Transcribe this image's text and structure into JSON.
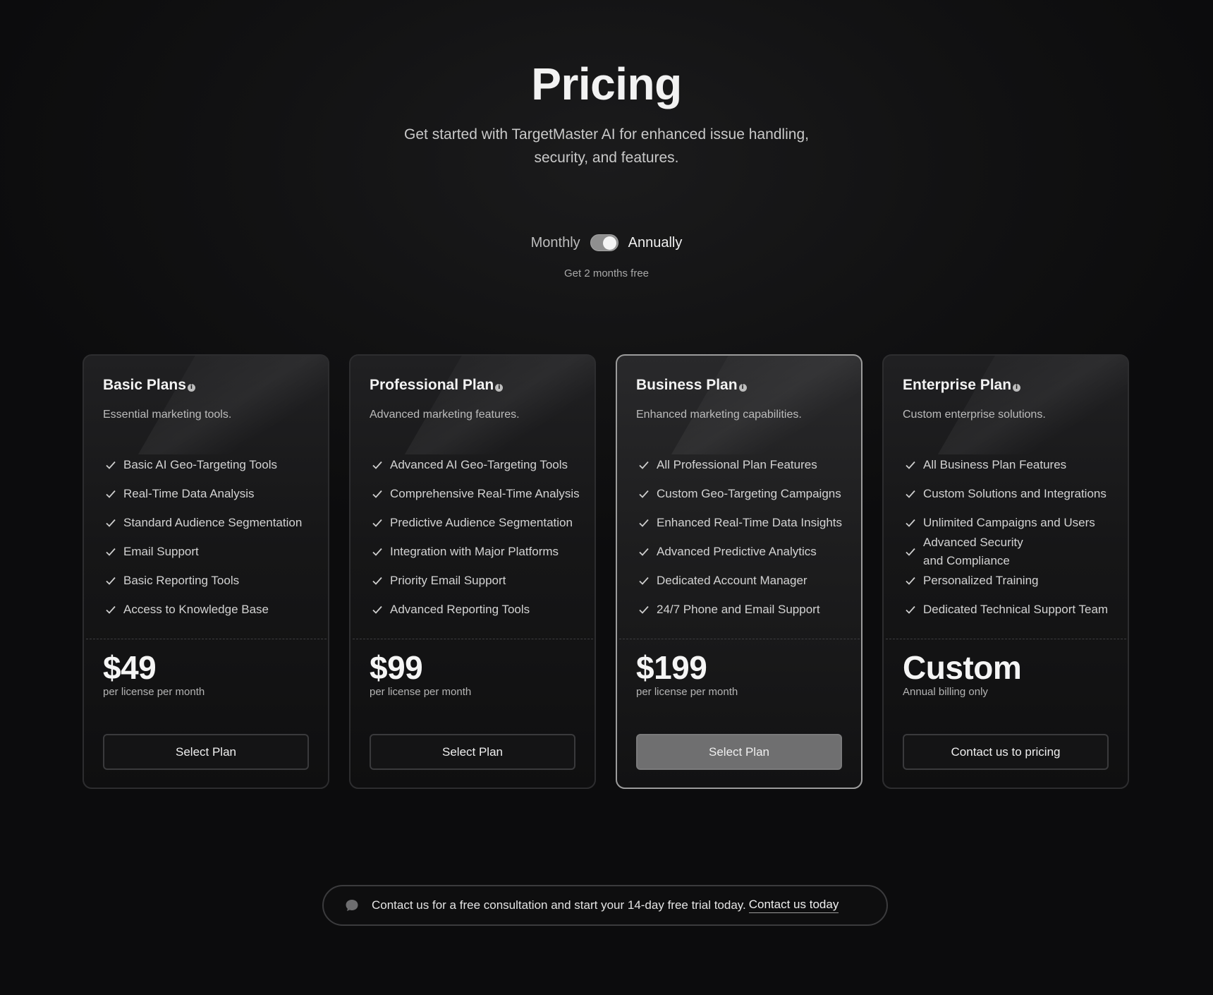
{
  "header": {
    "title": "Pricing",
    "subtitle": "Get started with TargetMaster AI for enhanced issue handling, security, and features."
  },
  "billing": {
    "monthly_label": "Monthly",
    "annually_label": "Annually",
    "selected": "Annually",
    "note": "Get 2 months free"
  },
  "plans": [
    {
      "name": "Basic Plans",
      "description": "Essential marketing tools.",
      "features": [
        "Basic AI Geo-Targeting Tools",
        "Real-Time Data Analysis",
        "Standard Audience Segmentation",
        "Email Support",
        "Basic Reporting Tools",
        "Access to Knowledge Base"
      ],
      "price": "$49",
      "price_note": "per license per month",
      "button": "Select Plan"
    },
    {
      "name": "Professional Plan",
      "description": "Advanced marketing features.",
      "features": [
        "Advanced AI Geo-Targeting Tools",
        "Comprehensive Real-Time Analysis",
        "Predictive Audience Segmentation",
        "Integration with Major Platforms",
        "Priority Email Support",
        "Advanced Reporting Tools"
      ],
      "price": "$99",
      "price_note": "per license per month",
      "button": "Select Plan"
    },
    {
      "name": "Business Plan",
      "description": "Enhanced marketing capabilities.",
      "features": [
        "All Professional Plan Features",
        "Custom Geo-Targeting Campaigns",
        "Enhanced Real-Time Data Insights",
        "Advanced Predictive Analytics",
        "Dedicated Account Manager",
        "24/7 Phone and Email Support"
      ],
      "price": "$199",
      "price_note": "per license per month",
      "button": "Select Plan"
    },
    {
      "name": "Enterprise Plan",
      "description": "Custom enterprise solutions.",
      "features": [
        "All Business Plan Features",
        "Custom Solutions and Integrations",
        "Unlimited Campaigns and Users",
        "Advanced Security and Compliance",
        "Personalized Training",
        "Dedicated Technical Support Team"
      ],
      "price": "Custom",
      "price_note": "Annual billing only",
      "button": "Contact us to pricing"
    }
  ],
  "banner": {
    "icon": "chat-bubble-icon",
    "text": "Contact us for a free consultation and start your 14-day free trial today.",
    "link": "Contact us today"
  },
  "colors": {
    "background": "#0c0c0d",
    "card_border": "#2d2d2f",
    "featured_border": "#9c9c9c",
    "featured_button": "#6f6f70"
  }
}
